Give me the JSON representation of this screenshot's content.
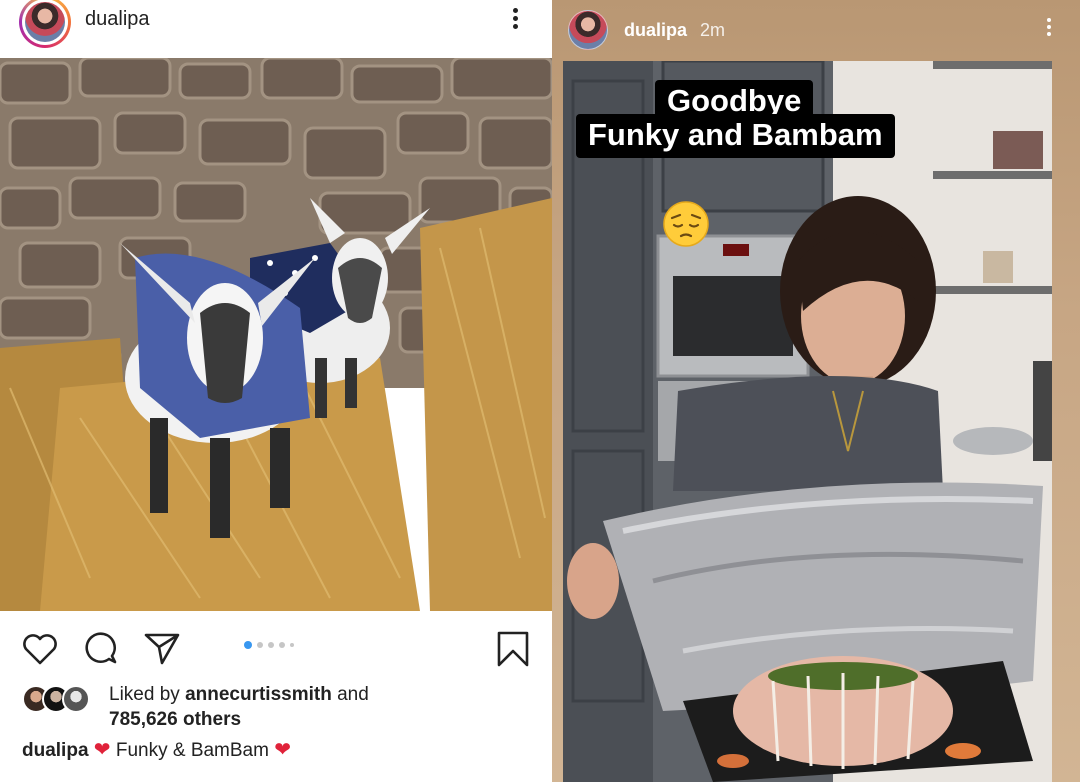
{
  "post": {
    "username": "dualipa",
    "more_icon": "more-vertical-icon",
    "actions": {
      "like_icon": "heart-outline-icon",
      "comment_icon": "comment-bubble-icon",
      "share_icon": "paper-plane-icon",
      "save_icon": "bookmark-icon"
    },
    "carousel": {
      "total": 5,
      "active": 1
    },
    "likes": {
      "prefix": "Liked by",
      "user": "annecurtissmith",
      "and": "and",
      "others": "785,626 others"
    },
    "caption": {
      "username": "dualipa",
      "text": "Funky & BamBam"
    },
    "colors": {
      "accent": "#3897f0",
      "heart": "#e0223a",
      "text": "#222222"
    }
  },
  "story": {
    "username": "dualipa",
    "time": "2m",
    "more_icon": "more-vertical-icon",
    "text_line1": "Goodbye",
    "text_line2": "Funky and Bambam",
    "sticker": "pensive-face-emoji",
    "colors": {
      "background": "#c8a987",
      "text_bg": "#000000"
    }
  }
}
